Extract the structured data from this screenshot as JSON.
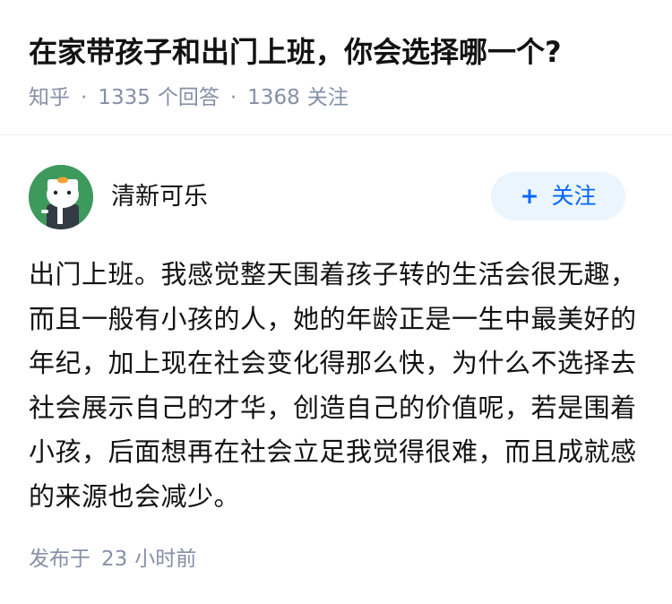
{
  "question": {
    "title": "在家带孩子和出门上班，你会选择哪一个?",
    "source": "知乎",
    "separator": "·",
    "answer_count": "1335",
    "answer_count_label": "个回答",
    "follower_count": "1368",
    "follower_count_label": "关注"
  },
  "answer": {
    "author_name": "清新可乐",
    "follow_button_plus": "+",
    "follow_button_label": "关注",
    "content": "出门上班。我感觉整天围着孩子转的生活会很无趣，而且一般有小孩的人，她的年龄正是一生中最美好的年纪，加上现在社会变化得那么快，为什么不选择去社会展示自己的才华，创造自己的价值呢，若是围着小孩，后面想再在社会立足我觉得很难，而且成就感的来源也会减少。",
    "published_prefix": "发布于",
    "published_number": "23",
    "published_unit": "小时前"
  },
  "colors": {
    "accent": "#0066ff",
    "follow_button_bg": "#ebf5fd",
    "meta_text": "#8590a6",
    "avatar_bg": "#3e9a5c"
  }
}
